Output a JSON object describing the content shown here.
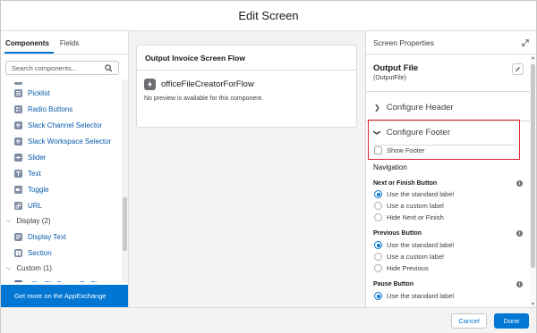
{
  "dialog": {
    "title": "Edit Screen"
  },
  "left_panel": {
    "tabs": [
      {
        "label": "Components",
        "active": true
      },
      {
        "label": "Fields",
        "active": false
      }
    ],
    "search": {
      "placeholder": "Search components..."
    },
    "items": [
      {
        "label": "Picklist"
      },
      {
        "label": "Radio Buttons"
      },
      {
        "label": "Slack Channel Selector"
      },
      {
        "label": "Slack Workspace Selector"
      },
      {
        "label": "Slider"
      },
      {
        "label": "Text"
      },
      {
        "label": "Toggle"
      },
      {
        "label": "URL"
      }
    ],
    "group_display": {
      "label": "Display (2)"
    },
    "display_items": [
      {
        "label": "Display Text"
      },
      {
        "label": "Section"
      }
    ],
    "group_custom": {
      "label": "Custom (1)"
    },
    "custom_items": [
      {
        "label": "officeFileCreatorForFlow"
      }
    ],
    "appexchange_label": "Get more on the AppExchange"
  },
  "canvas": {
    "card_title": "Output Invoice Screen Flow",
    "component_name": "officeFileCreatorForFlow",
    "no_preview": "No preview is available for this component."
  },
  "right_panel": {
    "title": "Screen Properties",
    "element_title": "Output File",
    "element_api_name": "(OutputFile)",
    "configure_header": "Configure Header",
    "configure_footer": "Configure Footer",
    "show_footer": "Show Footer",
    "navigation": "Navigation",
    "next_finish": {
      "label": "Next or Finish Button",
      "options": [
        "Use the standard label",
        "Use a custom label",
        "Hide Next or Finish"
      ],
      "selected": 0
    },
    "previous": {
      "label": "Previous Button",
      "options": [
        "Use the standard label",
        "Use a custom label",
        "Hide Previous"
      ],
      "selected": 0
    },
    "pause": {
      "label": "Pause Button",
      "options": [
        "Use the standard label"
      ],
      "selected": 0
    }
  },
  "footer": {
    "cancel_label": "Cancel",
    "done_label": "Done"
  },
  "colors": {
    "brand": "#0176d3",
    "highlight_box": "#e0242f",
    "link": "#0b5cab"
  }
}
